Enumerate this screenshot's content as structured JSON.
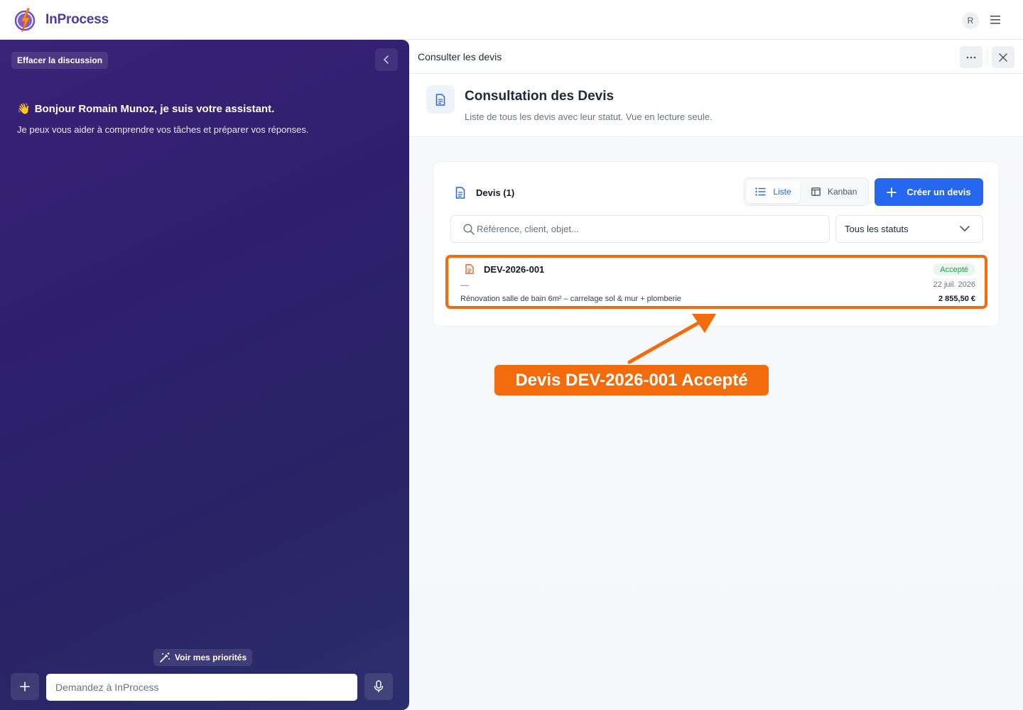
{
  "app": {
    "name": "InProcess",
    "avatar_initial": "R"
  },
  "chat": {
    "clear_label": "Effacer la discussion",
    "greeting_emoji": "👋",
    "greeting": "Bonjour Romain Munoz, je suis votre assistant.",
    "subtitle": "Je peux vous aider à comprendre vos tâches et préparer vos réponses.",
    "priorities_label": "Voir mes priorités",
    "input_placeholder": "Demandez à InProcess"
  },
  "panel": {
    "header_title": "Consulter les devis",
    "title": "Consultation des Devis",
    "subtitle": "Liste de tous les devis avec leur statut. Vue en lecture seule."
  },
  "devis": {
    "heading": "Devis (1)",
    "view_list": "Liste",
    "view_kanban": "Kanban",
    "create_label": "Créer un devis",
    "search_placeholder": "Référence, client, objet...",
    "status_filter": "Tous les statuts",
    "rows": [
      {
        "reference": "DEV-2026-001",
        "client": "—",
        "object": "Rénovation salle de bain 6m² – carrelage sol & mur + plomberie",
        "status": "Accepté",
        "date": "22 juil. 2026",
        "amount": "2 855,50 €"
      }
    ]
  },
  "annotation": {
    "label": "Devis DEV-2026-001 Accepté",
    "color": "#f26c0d"
  },
  "colors": {
    "brand": "#4c3aa8",
    "primary": "#2667f0",
    "success": "#16a34a",
    "chat_bg": "#2e1f6e"
  }
}
